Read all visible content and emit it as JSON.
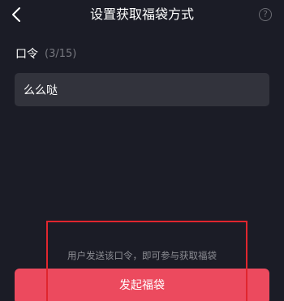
{
  "header": {
    "title": "设置获取福袋方式",
    "back_icon": "chevron-left-icon",
    "help_icon": "question-circle-icon",
    "help_glyph": "?"
  },
  "field": {
    "label": "口令",
    "count": "(3/15)",
    "value": "么么哒"
  },
  "footer": {
    "hint": "用户发送该口令，即可参与获取福袋",
    "submit_label": "发起福袋"
  },
  "colors": {
    "background": "#1b1c26",
    "input_background": "#32333c",
    "submit_button": "#ec4a5e",
    "highlight_border": "#e0262e"
  }
}
